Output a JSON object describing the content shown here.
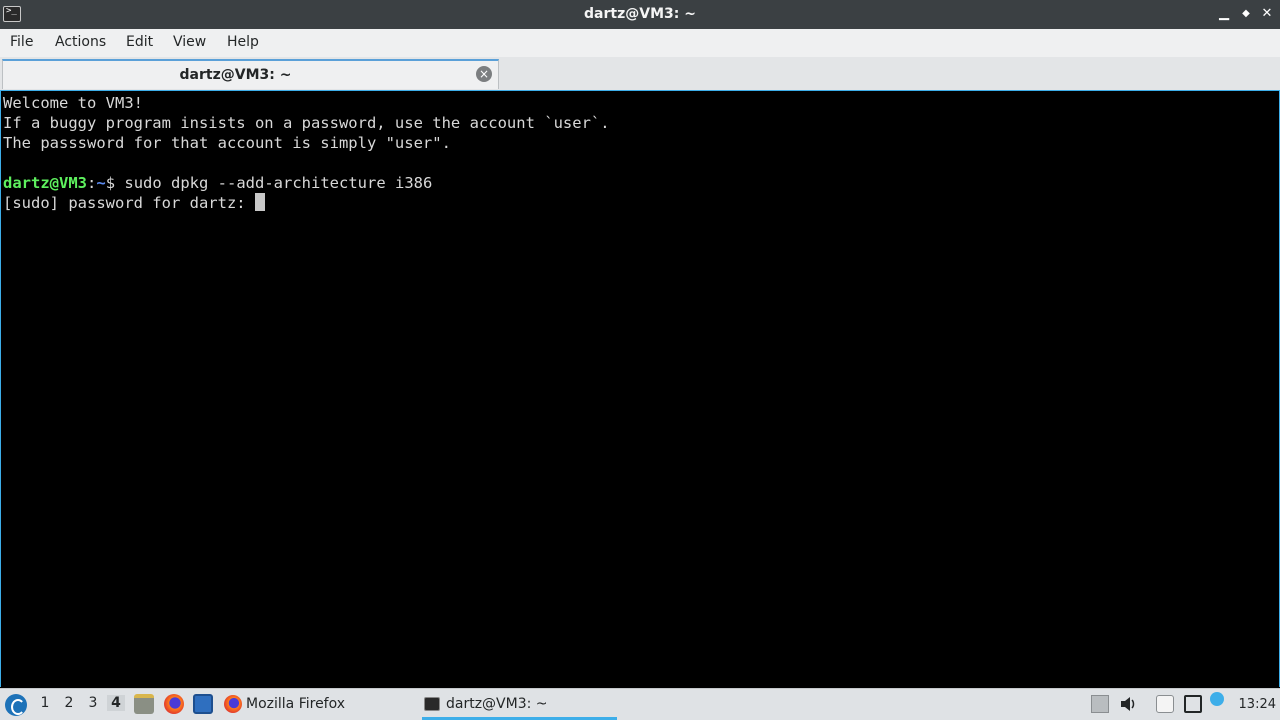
{
  "window": {
    "title": "dartz@VM3: ~",
    "app_icon_glyph": ">_"
  },
  "window_controls": {
    "minimize": "▁",
    "maximize": "◆",
    "close": "✕"
  },
  "menubar": {
    "items": [
      "File",
      "Actions",
      "Edit",
      "View",
      "Help"
    ]
  },
  "tabs": [
    {
      "label": "dartz@VM3: ~",
      "close_glyph": "×"
    }
  ],
  "terminal": {
    "lines": [
      "Welcome to VM3!",
      "If a buggy program insists on a password, use the account `user`.",
      "The passsword for that account is simply \"user\"."
    ],
    "prompt": {
      "user_host": "dartz@VM3",
      "sep": ":",
      "path": "~",
      "symbol": "$ ",
      "command": "sudo dpkg --add-architecture i386"
    },
    "sudo_prompt": "[sudo] password for dartz: "
  },
  "taskbar": {
    "desktops": [
      "1",
      "2",
      "3",
      "4"
    ],
    "active_desktop": "4",
    "tasks": [
      {
        "label": "Mozilla Firefox",
        "icon": "firefox-icon"
      },
      {
        "label": "dartz@VM3: ~",
        "icon": "terminal-icon"
      }
    ],
    "clock": "13:24"
  },
  "colors": {
    "accent": "#3daee9",
    "prompt_user": "#5ef05e",
    "prompt_path": "#5c8bf0",
    "titlebar": "#3b4043"
  }
}
